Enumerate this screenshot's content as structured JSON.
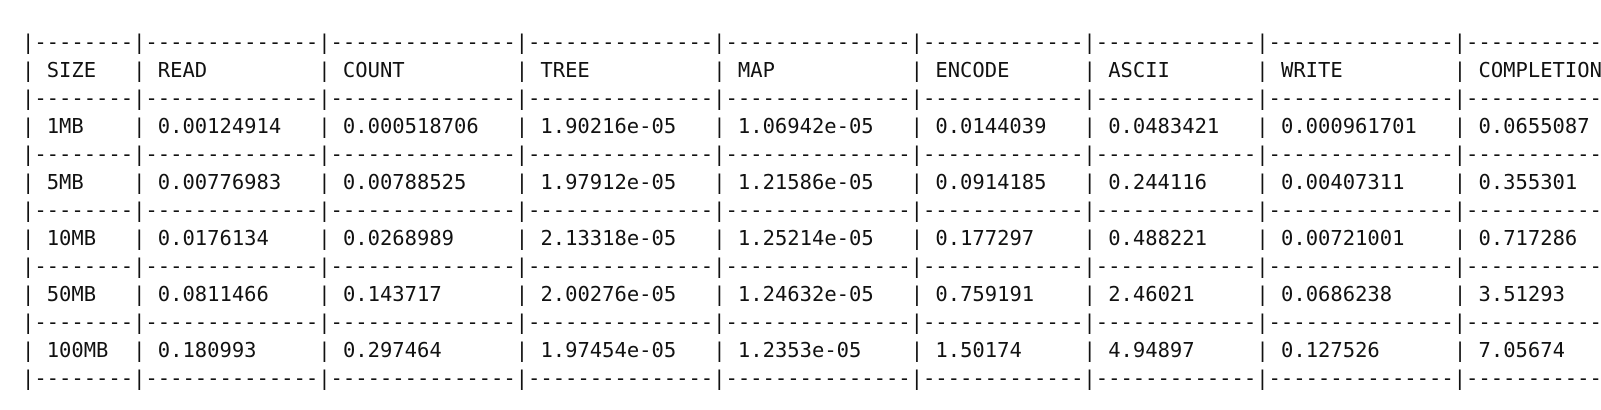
{
  "table": {
    "columns": [
      "SIZE",
      "READ",
      "COUNT",
      "TREE",
      "MAP",
      "ENCODE",
      "ASCII",
      "WRITE",
      "COMPLETION"
    ],
    "rows": [
      [
        "1MB",
        "0.00124914",
        "0.000518706",
        "1.90216e-05",
        "1.06942e-05",
        "0.0144039",
        "0.0483421",
        "0.000961701",
        "0.0655087"
      ],
      [
        "5MB",
        "0.00776983",
        "0.00788525",
        "1.97912e-05",
        "1.21586e-05",
        "0.0914185",
        "0.244116",
        "0.00407311",
        "0.355301"
      ],
      [
        "10MB",
        "0.0176134",
        "0.0268989",
        "2.13318e-05",
        "1.25214e-05",
        "0.177297",
        "0.488221",
        "0.00721001",
        "0.717286"
      ],
      [
        "50MB",
        "0.0811466",
        "0.143717",
        "2.00276e-05",
        "1.24632e-05",
        "0.759191",
        "2.46021",
        "0.0686238",
        "3.51293"
      ],
      [
        "100MB",
        "0.180993",
        "0.297464",
        "1.97454e-05",
        "1.2353e-05",
        "1.50174",
        "4.94897",
        "0.127526",
        "7.05674"
      ]
    ]
  }
}
